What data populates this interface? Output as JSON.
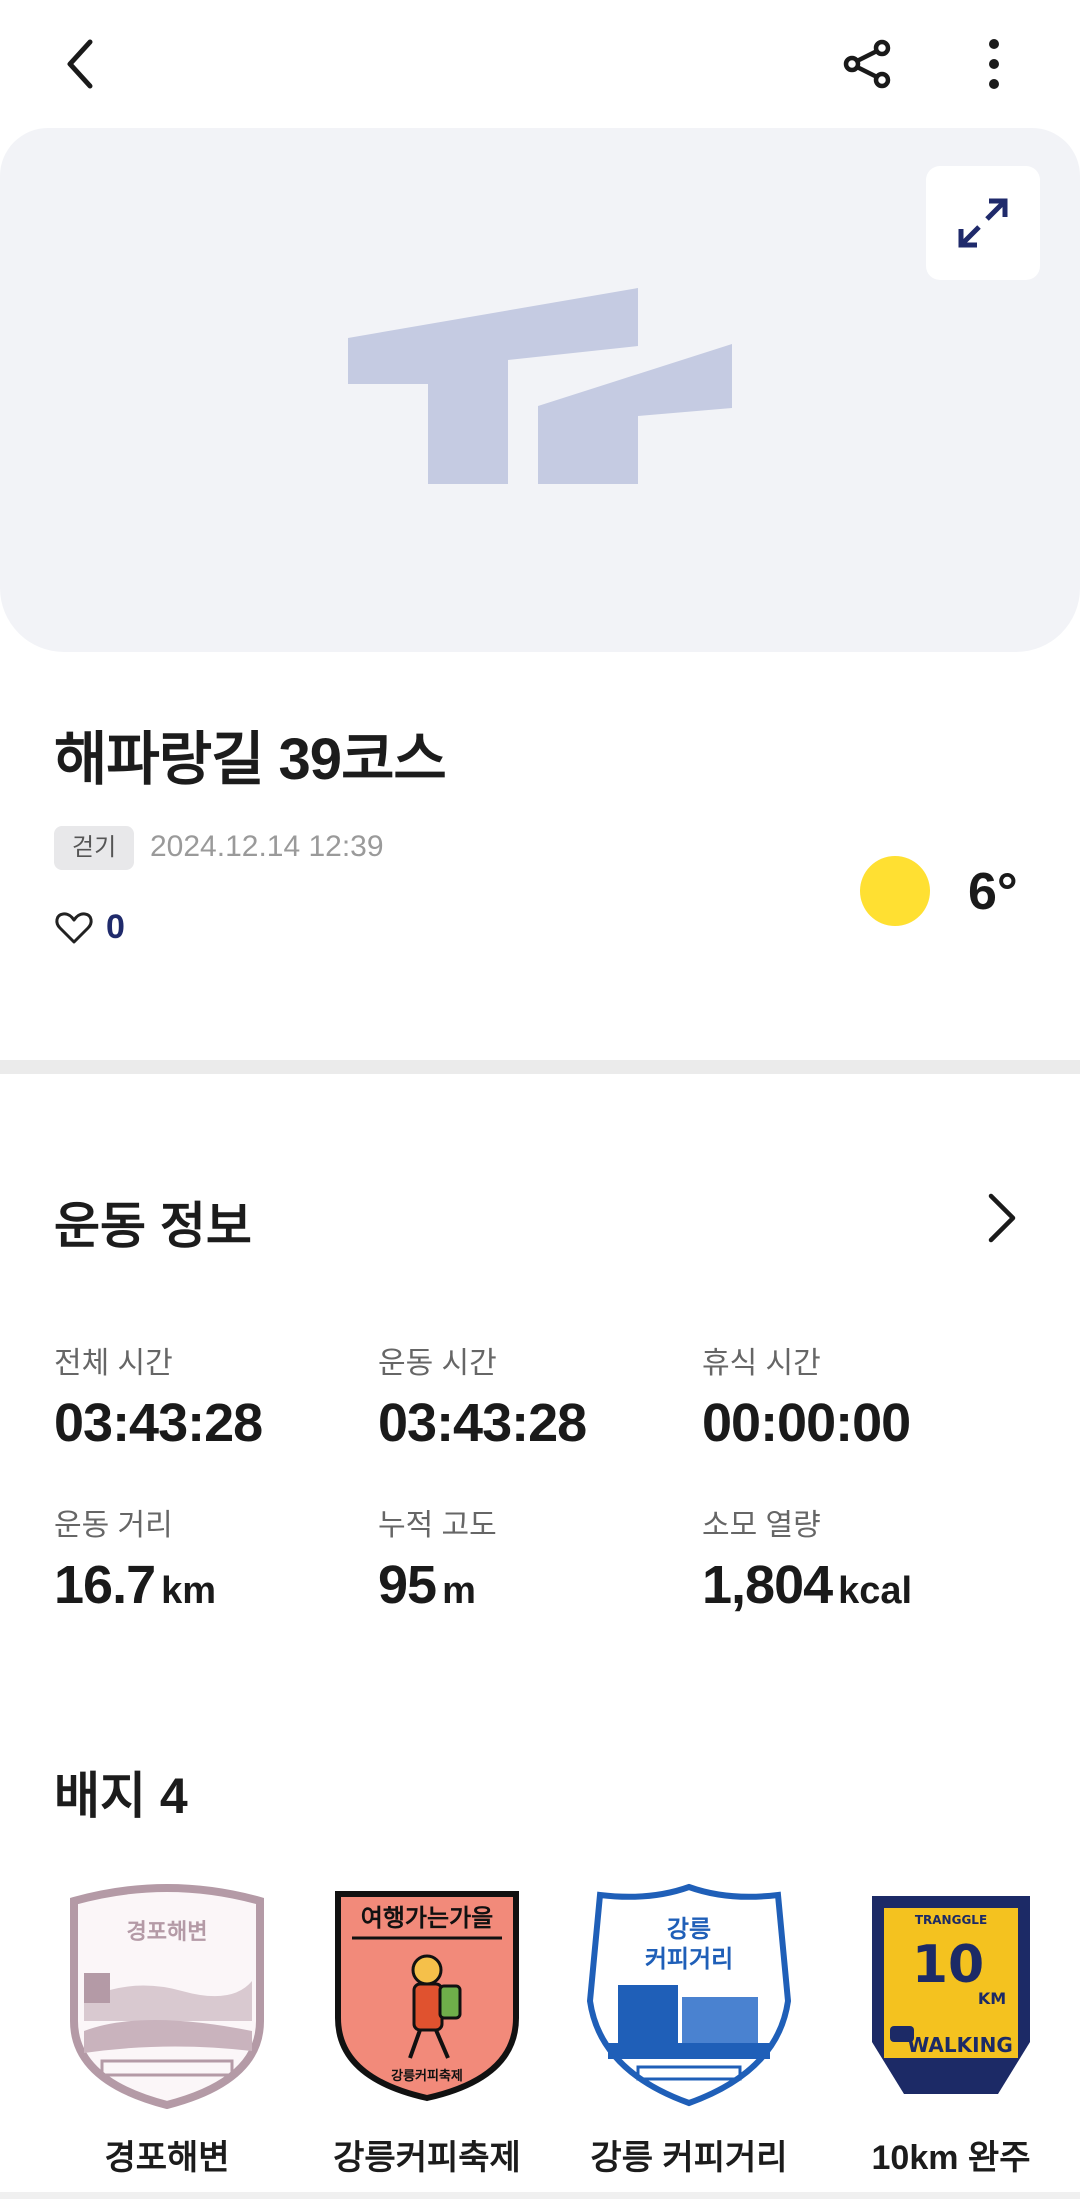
{
  "header": {
    "back_icon": "chevron-left-icon",
    "share_icon": "share-icon",
    "more_icon": "more-vertical-icon"
  },
  "map": {
    "expand_icon": "expand-icon",
    "logo": "logo-icon",
    "background_color": "#f2f3f7",
    "logo_color": "#c5cbe2"
  },
  "activity": {
    "title": "해파랑길 39코스",
    "type": "걷기",
    "datetime": "2024.12.14 12:39",
    "likes": "0",
    "weather_icon": "sun-icon",
    "temperature": "6°"
  },
  "exercise": {
    "title": "운동 정보",
    "stats": [
      {
        "label": "전체 시간",
        "value": "03:43:28",
        "unit": ""
      },
      {
        "label": "운동 시간",
        "value": "03:43:28",
        "unit": ""
      },
      {
        "label": "휴식 시간",
        "value": "00:00:00",
        "unit": ""
      },
      {
        "label": "운동 거리",
        "value": "16.7",
        "unit": "km"
      },
      {
        "label": "누적 고도",
        "value": "95",
        "unit": "m"
      },
      {
        "label": "소모 열량",
        "value": "1,804",
        "unit": "kcal"
      }
    ]
  },
  "badges": {
    "title": "배지 4",
    "items": [
      {
        "name": "경포해변",
        "art_text": "경포해변",
        "color": "#b49aa6"
      },
      {
        "name": "강릉커피축제",
        "art_text": "여행가는가을",
        "art_subtext": "강릉커피축제",
        "color": "#f28a7a"
      },
      {
        "name": "강릉 커피거리",
        "art_text": "강릉",
        "art_text2": "커피거리",
        "color": "#1f5fb8"
      },
      {
        "name": "10km 완주",
        "art_top": "TRANGGLE",
        "art_num": "10",
        "art_unit": "KM",
        "art_bottom": "WALKING",
        "color": "#1c2a66"
      }
    ]
  },
  "colors": {
    "accent_navy": "#1f2a6b",
    "sun_yellow": "#ffe032"
  }
}
